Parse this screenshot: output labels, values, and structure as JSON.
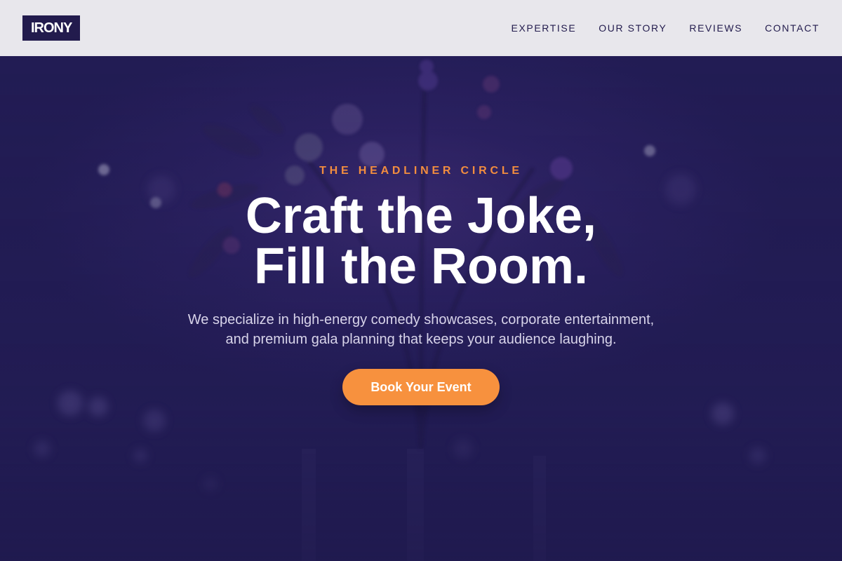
{
  "header": {
    "logo_text": "IRONY",
    "nav": [
      {
        "label": "EXPERTISE"
      },
      {
        "label": "OUR STORY"
      },
      {
        "label": "REVIEWS"
      },
      {
        "label": "CONTACT"
      }
    ]
  },
  "hero": {
    "eyebrow": "THE HEADLINER CIRCLE",
    "headline_line1": "Craft the Joke,",
    "headline_line2": "Fill the Room.",
    "subtext_line1": "We specialize in high-energy comedy showcases, corporate entertainment,",
    "subtext_line2": "and premium gala planning that keeps your audience laughing.",
    "cta_label": "Book Your Event"
  },
  "colors": {
    "header_bg": "#e8e7ec",
    "brand_navy": "#221b4d",
    "hero_bg": "#221c52",
    "accent_orange": "#f7913e"
  }
}
